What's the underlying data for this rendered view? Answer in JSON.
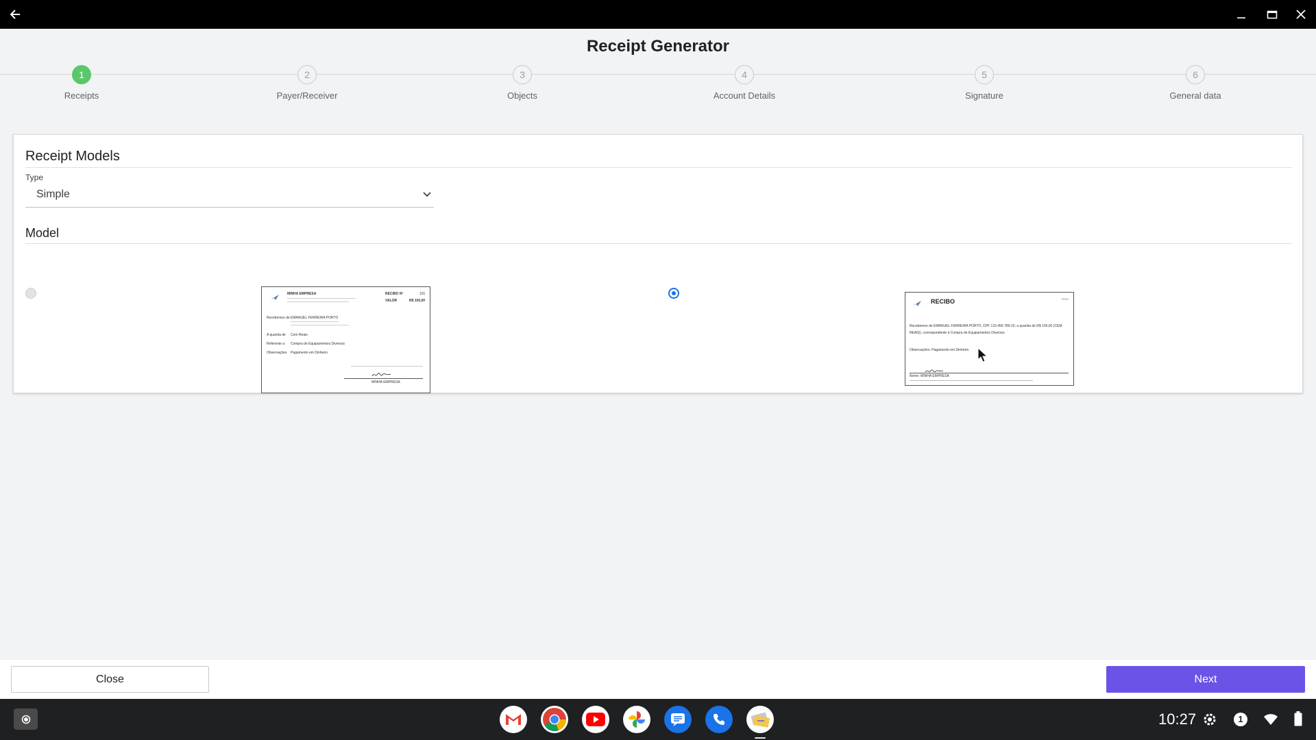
{
  "window": {
    "back_icon": "arrow-back-icon",
    "minimize_icon": "minimize-icon",
    "maximize_icon": "maximize-icon",
    "close_icon": "close-icon"
  },
  "app": {
    "title": "Receipt Generator"
  },
  "stepper": {
    "steps": [
      {
        "number": "1",
        "label": "Receipts",
        "active": true
      },
      {
        "number": "2",
        "label": "Payer/Receiver",
        "active": false
      },
      {
        "number": "3",
        "label": "Objects",
        "active": false
      },
      {
        "number": "4",
        "label": "Account Details",
        "active": false
      },
      {
        "number": "5",
        "label": "Signature",
        "active": false
      },
      {
        "number": "6",
        "label": "General data",
        "active": false
      }
    ],
    "active_color": "#5cc66b"
  },
  "card": {
    "title": "Receipt Models",
    "type_label": "Type",
    "type_value": "Simple",
    "model_title": "Model",
    "models": [
      {
        "selected": false,
        "preview": {
          "company": "MINHA EMPRESA",
          "recibo_no_label": "RECIBO Nº",
          "recibo_no": "101",
          "valor_label": "VALOR",
          "valor": "R$ 100,00",
          "lines": [
            "Recebemos de",
            "A quantia de",
            "Referente a",
            "Observações"
          ],
          "values": [
            "EMANUEL FERREIRA PORTO",
            "Cem Reais",
            "Compra de Equipamentos Diversos",
            "Pagamento em Dinheiro"
          ],
          "footer": "MINHA EMPRESA"
        }
      },
      {
        "selected": true,
        "preview": {
          "title": "RECIBO",
          "body": "Recebemos de EMANUEL FERREIRA PORTO, CPF 123.456.789-10, a quantia de R$ 100,00 (CEM REAIS), correspondente à Compra de Equipamentos Diversos",
          "obs": "Observações: Pagamento em Dinheiro",
          "footer": "Nome: MINHA EMPRESA"
        }
      }
    ]
  },
  "actions": {
    "close_label": "Close",
    "next_label": "Next",
    "next_color": "#6b53e8"
  },
  "shelf": {
    "launcher_icon": "launcher-icon",
    "apps": [
      "gmail-icon",
      "chrome-icon",
      "youtube-icon",
      "photos-icon",
      "messages-icon",
      "phone-icon",
      "receipt-app-icon"
    ],
    "time": "10:27",
    "tray": [
      "settings-icon",
      "notification-icon",
      "wifi-icon",
      "battery-icon"
    ],
    "notification_count": "1"
  }
}
